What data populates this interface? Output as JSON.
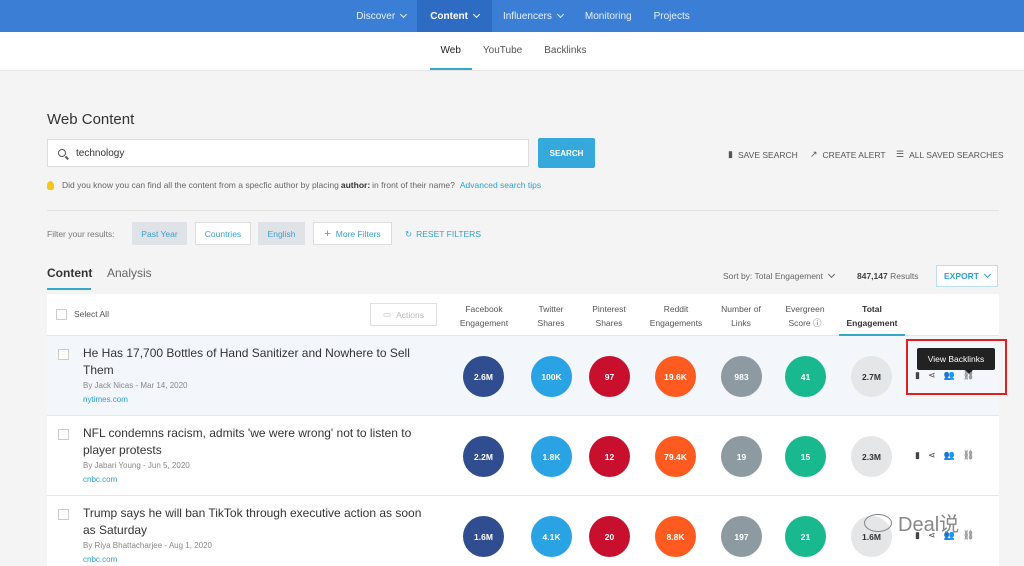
{
  "topnav": {
    "items": [
      {
        "label": "Discover",
        "dropdown": true
      },
      {
        "label": "Content",
        "dropdown": true,
        "active": true
      },
      {
        "label": "Influencers",
        "dropdown": true
      },
      {
        "label": "Monitoring"
      },
      {
        "label": "Projects"
      }
    ]
  },
  "subnav": {
    "tabs": [
      "Web",
      "YouTube",
      "Backlinks"
    ],
    "active": "Web"
  },
  "page_title": "Web Content",
  "search": {
    "value": "technology",
    "button": "SEARCH"
  },
  "toolbar": {
    "save_search": "SAVE SEARCH",
    "create_alert": "CREATE ALERT",
    "all_saved": "ALL SAVED SEARCHES"
  },
  "tip": {
    "text_before": "Did you know you can find all the content from a specfic author by placing",
    "bold": "author:",
    "text_after": "in front of their name?",
    "link": "Advanced search tips"
  },
  "filters": {
    "label": "Filter your results:",
    "past_year": "Past Year",
    "countries": "Countries",
    "english": "English",
    "more": "More Filters",
    "reset": "RESET FILTERS"
  },
  "content_tabs": {
    "content": "Content",
    "analysis": "Analysis"
  },
  "sort": {
    "label": "Sort by: Total Engagement",
    "count": "847,147",
    "results": "Results",
    "export": "EXPORT"
  },
  "table": {
    "select_all": "Select All",
    "actions": "Actions",
    "columns": [
      {
        "l1": "Facebook",
        "l2": "Engagement"
      },
      {
        "l1": "Twitter",
        "l2": "Shares"
      },
      {
        "l1": "Pinterest",
        "l2": "Shares"
      },
      {
        "l1": "Reddit",
        "l2": "Engagements"
      },
      {
        "l1": "Number of",
        "l2": "Links"
      },
      {
        "l1": "Evergreen",
        "l2": "Score ⓘ"
      },
      {
        "l1": "Total",
        "l2": "Engagement"
      }
    ],
    "metric_colors": [
      "#2f4d8f",
      "#29a3e3",
      "#c8102e",
      "#ff5a1f",
      "#8e9aa2",
      "#19b98f"
    ],
    "rows": [
      {
        "title": "He Has 17,700 Bottles of Hand Sanitizer and Nowhere to Sell Them",
        "by": "By Jack Nicas - Mar 14, 2020",
        "source": "nytimes.com",
        "metrics": [
          "2.6M",
          "100K",
          "97",
          "19.6K",
          "983",
          "41",
          "2.7M"
        ]
      },
      {
        "title": "NFL condemns racism, admits 'we were wrong' not to listen to player protests",
        "by": "By Jabari Young - Jun 5, 2020",
        "source": "cnbc.com",
        "metrics": [
          "2.2M",
          "1.8K",
          "12",
          "79.4K",
          "19",
          "15",
          "2.3M"
        ]
      },
      {
        "title": "Trump says he will ban TikTok through executive action as soon as Saturday",
        "by": "By Riya Bhattacharjee - Aug 1, 2020",
        "source": "cnbc.com",
        "metrics": [
          "1.6M",
          "4.1K",
          "20",
          "8.8K",
          "197",
          "21",
          "1.6M"
        ]
      }
    ]
  },
  "tooltip": "View Backlinks",
  "watermark": "Deal说",
  "accent": "#35a8c9",
  "topbar_color": "#3b7ed6"
}
